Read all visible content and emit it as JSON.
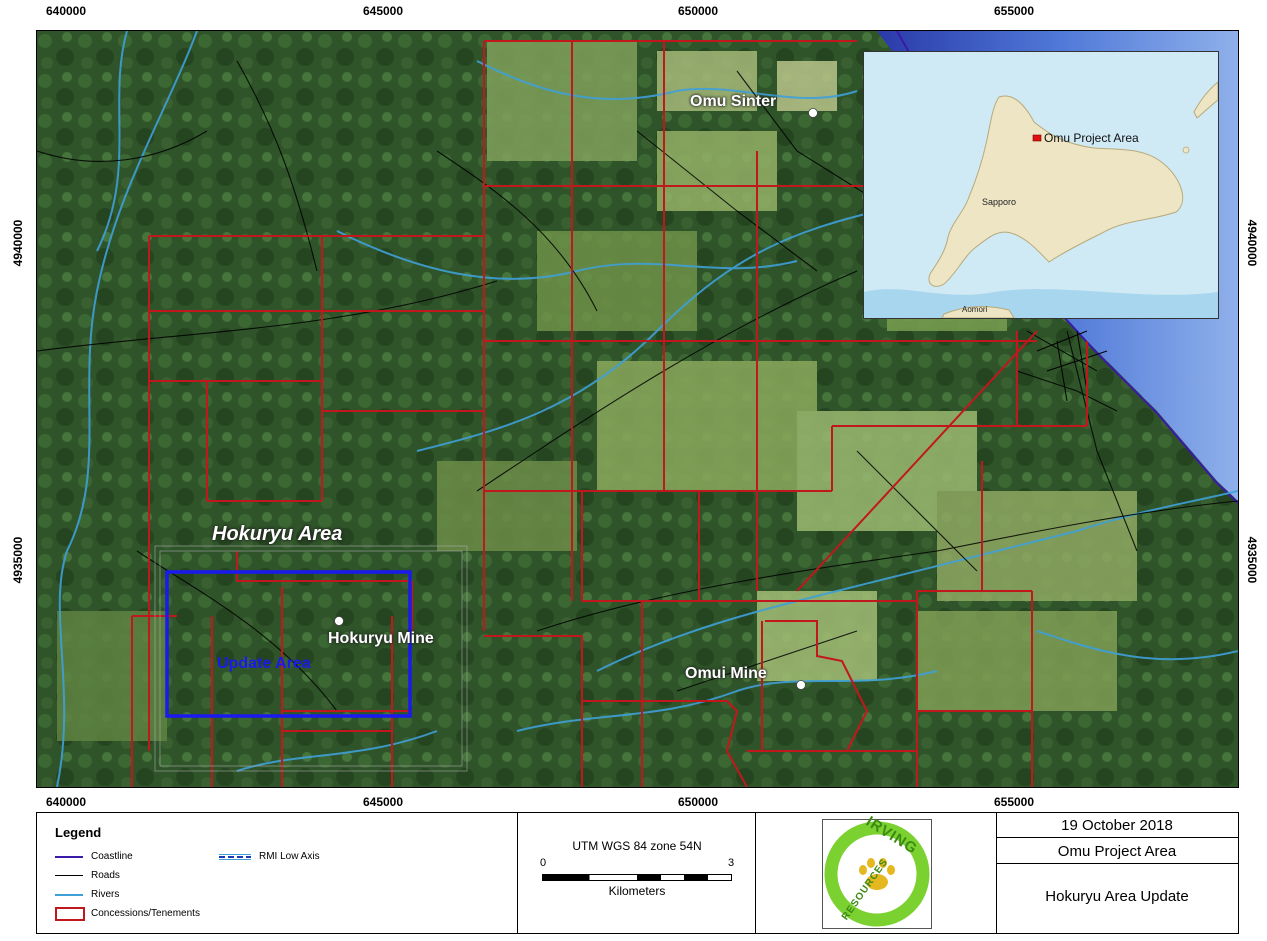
{
  "ticks": {
    "x_top": [
      "640000",
      "645000",
      "650000",
      "655000"
    ],
    "x_bottom": [
      "640000",
      "645000",
      "650000",
      "655000"
    ],
    "y_left": [
      "4940000",
      "4935000"
    ],
    "y_right": [
      "4940000",
      "4935000"
    ]
  },
  "map_labels": {
    "omu_sinter": "Omu Sinter",
    "hokuryu_area": "Hokuryu Area",
    "hokuryu_mine": "Hokuryu Mine",
    "update_area": "Update Area",
    "omui_mine": "Omui Mine"
  },
  "inset": {
    "project_label": "Omu Project Area",
    "sapporo": "Sapporo",
    "aomori": "Aomori"
  },
  "legend": {
    "title": "Legend",
    "coastline": "Coastline",
    "roads": "Roads",
    "rivers": "Rivers",
    "concessions": "Concessions/Tenements",
    "rmi": "RMI Low Axis"
  },
  "scale": {
    "projection": "UTM WGS 84 zone 54N",
    "min": "0",
    "max": "3",
    "units": "Kilometers"
  },
  "logo_text": {
    "top": "IRVING",
    "bottom": "RESOURCES"
  },
  "info": {
    "date": "19 October 2018",
    "project": "Omu Project Area",
    "title": "Hokuryu Area Update"
  },
  "colors": {
    "concession": "#c0181c",
    "update_area": "#1a1aee",
    "rivers": "#3fa0d8",
    "roads": "#000000",
    "coastline": "#3a1aa8",
    "logo_green": "#7bd12f"
  }
}
